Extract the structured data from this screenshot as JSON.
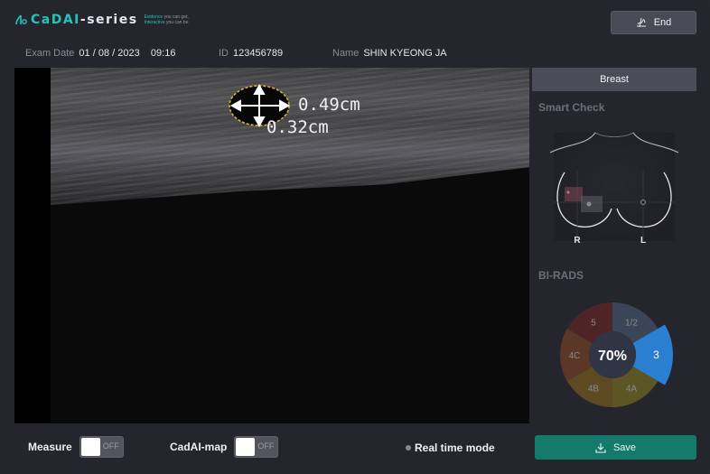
{
  "header": {
    "logo_text_main": "CaDAI",
    "logo_text_dash": "-series",
    "logo_tag_line1_hl": "Evidence",
    "logo_tag_line1": " you can get,",
    "logo_tag_line2_hl": "Interactive",
    "logo_tag_line2": " you can be",
    "end_label": "End"
  },
  "exam_info": {
    "date_label": "Exam Date",
    "date_value": "01 / 08 / 2023    09:16",
    "id_label": "ID",
    "id_value": "123456789",
    "name_label": "Name",
    "name_value": "SHIN KYEONG JA"
  },
  "image_view": {
    "measure_width": "0.49cm",
    "measure_height": "0.32cm"
  },
  "panel": {
    "tab_label": "Breast",
    "smart_check_title": "Smart Check",
    "right_label": "R",
    "left_label": "L",
    "birads_title": "BI-RADS",
    "birads_center": "70%",
    "birads_segments": [
      {
        "label": "1/2",
        "color": "#3a4658",
        "active": false
      },
      {
        "label": "3",
        "color": "#2a7fd0",
        "active": true
      },
      {
        "label": "4A",
        "color": "#5c5524",
        "active": false
      },
      {
        "label": "4B",
        "color": "#5e4a22",
        "active": false
      },
      {
        "label": "4C",
        "color": "#5a3726",
        "active": false
      },
      {
        "label": "5",
        "color": "#4f2426",
        "active": false
      }
    ]
  },
  "bottom": {
    "measure_label": "Measure",
    "measure_state": "OFF",
    "cadai_map_label": "CadAI-map",
    "cadai_map_state": "OFF",
    "realtime_label": "Real time mode",
    "save_label": "Save"
  },
  "colors": {
    "accent_teal": "#23c4b9",
    "save_green": "#147a6a",
    "birads_active_blue": "#2a7fd0"
  }
}
